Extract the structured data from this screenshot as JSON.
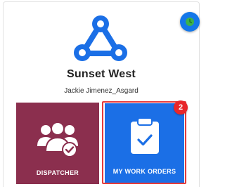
{
  "company": {
    "name": "Sunset West",
    "user": "Jackie Jimenez_Asgard",
    "logo_icon": "triangle-network-logo-icon"
  },
  "status": {
    "icon": "clock-icon",
    "color": "#1477e9"
  },
  "tiles": [
    {
      "label": "DISPATCHER",
      "icon": "user-group-check-icon",
      "color": "#8b2f4e"
    },
    {
      "label": "MY WORK ORDERS",
      "icon": "clipboard-check-icon",
      "color": "#1b6fe6",
      "badge": "2",
      "highlight_color": "#e53b3b"
    }
  ]
}
